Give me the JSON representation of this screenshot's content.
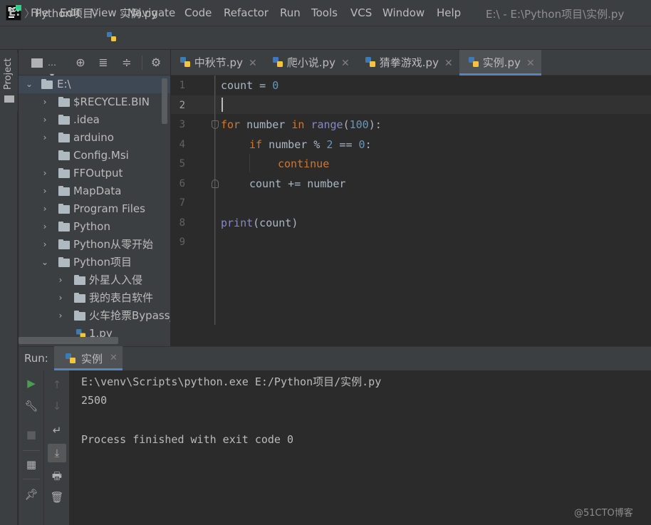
{
  "menubar": {
    "items": [
      {
        "label": "File",
        "key": "F"
      },
      {
        "label": "Edit",
        "key": "E"
      },
      {
        "label": "View",
        "key": "V"
      },
      {
        "label": "Navigate",
        "key": "N"
      },
      {
        "label": "Code",
        "key": "C"
      },
      {
        "label": "Refactor",
        "key": "R"
      },
      {
        "label": "Run",
        "key": "u"
      },
      {
        "label": "Tools",
        "key": "T"
      },
      {
        "label": "VCS",
        "key": "S"
      },
      {
        "label": "Window",
        "key": "W"
      },
      {
        "label": "Help",
        "key": "H"
      }
    ],
    "window_title": "E:\\ - E:\\Python项目\\实例.py"
  },
  "breadcrumb": {
    "root": "E:",
    "folder": "Python项目",
    "file": "实例.py"
  },
  "side_tab": {
    "label": "Project"
  },
  "project_tree": {
    "rows": [
      {
        "label": "E:\\",
        "type": "folder",
        "expanded": true
      },
      {
        "label": "$RECYCLE.BIN",
        "type": "folder",
        "expanded": false
      },
      {
        "label": ".idea",
        "type": "folder",
        "expanded": false
      },
      {
        "label": "arduino",
        "type": "folder",
        "expanded": false
      },
      {
        "label": "Config.Msi",
        "type": "folder",
        "expanded": null
      },
      {
        "label": "FFOutput",
        "type": "folder",
        "expanded": false
      },
      {
        "label": "MapData",
        "type": "folder",
        "expanded": false
      },
      {
        "label": "Program Files",
        "type": "folder",
        "expanded": false
      },
      {
        "label": "Python",
        "type": "folder",
        "expanded": false
      },
      {
        "label": "Python从零开始",
        "type": "folder",
        "expanded": false
      },
      {
        "label": "Python项目",
        "type": "folder",
        "expanded": true
      },
      {
        "label": "外星人入侵",
        "type": "folder",
        "expanded": false
      },
      {
        "label": "我的表白软件",
        "type": "folder",
        "expanded": false
      },
      {
        "label": "火车抢票Bypass_",
        "type": "folder",
        "expanded": false
      },
      {
        "label": "1.py",
        "type": "python-file",
        "expanded": null
      }
    ]
  },
  "editor": {
    "tabs": [
      {
        "label": "中秋节.py",
        "active": false
      },
      {
        "label": "爬小说.py",
        "active": false
      },
      {
        "label": "猜拳游戏.py",
        "active": false
      },
      {
        "label": "实例.py",
        "active": true
      }
    ],
    "line_numbers": [
      "1",
      "2",
      "3",
      "4",
      "5",
      "6",
      "7",
      "8",
      "9"
    ],
    "code": {
      "l1_a": "count = ",
      "l1_b": "0",
      "l3_for": "for",
      "l3_a": " number ",
      "l3_in": "in",
      "l3_b": " ",
      "l3_range": "range",
      "l3_c": "(",
      "l3_num": "100",
      "l3_d": "):",
      "l4_if": "if",
      "l4_a": " number % ",
      "l4_n2": "2",
      "l4_b": " == ",
      "l4_n0": "0",
      "l4_c": ":",
      "l5_continue": "continue",
      "l6": "count += number",
      "l8_print": "print",
      "l8_a": "(count)"
    }
  },
  "run_panel": {
    "label": "Run:",
    "tab_label": "实例",
    "output": [
      "E:\\venv\\Scripts\\python.exe E:/Python项目/实例.py",
      "2500",
      "",
      "Process finished with exit code 0"
    ]
  },
  "watermark": "@51CTO博客",
  "colors": {
    "accent": "#4a88c7",
    "keyword": "#cc7832",
    "number": "#6897bb",
    "builtin": "#8888c6",
    "run_green": "#499c54"
  }
}
